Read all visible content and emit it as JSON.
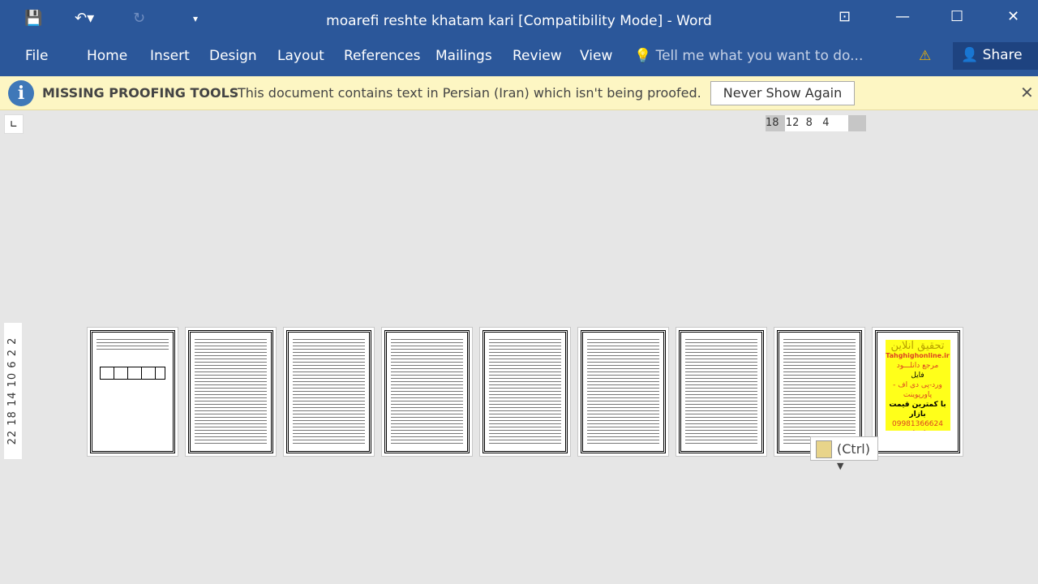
{
  "window": {
    "title": "moarefi reshte khatam kari [Compatibility Mode] - Word"
  },
  "ribbon": {
    "tabs": [
      "File",
      "Home",
      "Insert",
      "Design",
      "Layout",
      "References",
      "Mailings",
      "Review",
      "View"
    ],
    "tell_me": "Tell me what you want to do...",
    "share": "Share"
  },
  "message_bar": {
    "heading": "MISSING PROOFING TOOLS",
    "text": "This document contains text in Persian (Iran) which isn't being proofed.",
    "button": "Never Show Again"
  },
  "ruler": {
    "horizontal": "18  12  8   4",
    "vertical": "22 18 14 10 6 2 2"
  },
  "pages": {
    "count": 9,
    "ad": {
      "title": "تحقیق آنلاین",
      "site": "Tahghighonline.ir",
      "l1": "مرجع دانلـــود",
      "l2": "فایل",
      "l3": "ورد-پی دی اف - پاورپوینت",
      "l4": "با کمترین قیمت بازار",
      "l5": "09981366624 واتساپ"
    }
  },
  "paste_options": {
    "label": "(Ctrl)"
  }
}
